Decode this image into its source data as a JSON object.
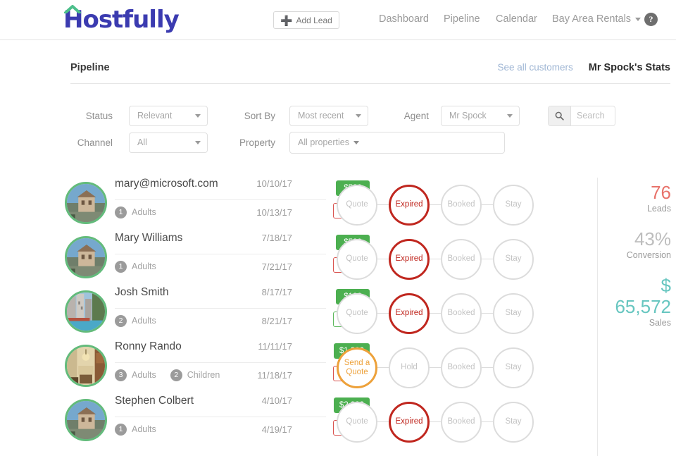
{
  "brand": {
    "name": "Hostfully",
    "roof_icon": "house-roof-icon",
    "color": "#3b3bb0",
    "accent": "#4cbf8b"
  },
  "topbar": {
    "add_lead_label": "Add Lead",
    "add_lead_icon": "plus-icon",
    "help_icon": "question-mark-icon",
    "nav": [
      {
        "label": "Dashboard",
        "dropdown": false
      },
      {
        "label": "Pipeline",
        "dropdown": false
      },
      {
        "label": "Calendar",
        "dropdown": false
      },
      {
        "label": "Bay Area Rentals",
        "dropdown": true
      }
    ]
  },
  "section": {
    "title": "Pipeline",
    "see_all_label": "See all customers",
    "stats_title": "Mr Spock's Stats"
  },
  "filters": {
    "status": {
      "label": "Status",
      "value": "Relevant"
    },
    "sort_by": {
      "label": "Sort By",
      "value": "Most recent"
    },
    "agent": {
      "label": "Agent",
      "value": "Mr Spock"
    },
    "channel": {
      "label": "Channel",
      "value": "All"
    },
    "property": {
      "label": "Property",
      "value": "All properties"
    },
    "search": {
      "placeholder": "Search",
      "value": "",
      "icon": "search-icon"
    }
  },
  "leads": [
    {
      "name": "mary@microsoft.com",
      "date_from": "10/10/17",
      "date_to": "10/13/17",
      "amount": "$520",
      "duration": "3 days",
      "duration_state": "alert",
      "adults": "1",
      "adults_label": "Adults",
      "children": null,
      "children_label": null,
      "avatar": "victorian-house-photo",
      "stages": [
        {
          "label": "Quote",
          "state": "inactive"
        },
        {
          "label": "Expired",
          "state": "expired"
        },
        {
          "label": "Booked",
          "state": "inactive"
        },
        {
          "label": "Stay",
          "state": "inactive"
        }
      ]
    },
    {
      "name": "Mary Williams",
      "date_from": "7/18/17",
      "date_to": "7/21/17",
      "amount": "$520",
      "duration": "3 days",
      "duration_state": "alert",
      "adults": "1",
      "adults_label": "Adults",
      "children": null,
      "children_label": null,
      "avatar": "victorian-house-photo",
      "stages": [
        {
          "label": "Quote",
          "state": "inactive"
        },
        {
          "label": "Expired",
          "state": "expired"
        },
        {
          "label": "Booked",
          "state": "inactive"
        },
        {
          "label": "Stay",
          "state": "inactive"
        }
      ]
    },
    {
      "name": "Josh Smith",
      "date_from": "8/17/17",
      "date_to": "8/21/17",
      "amount": "$100",
      "duration": "4 days",
      "duration_state": "ok",
      "adults": "2",
      "adults_label": "Adults",
      "children": null,
      "children_label": null,
      "avatar": "city-canal-photo",
      "stages": [
        {
          "label": "Quote",
          "state": "inactive"
        },
        {
          "label": "Expired",
          "state": "expired"
        },
        {
          "label": "Booked",
          "state": "inactive"
        },
        {
          "label": "Stay",
          "state": "inactive"
        }
      ]
    },
    {
      "name": "Ronny Rando",
      "date_from": "11/11/17",
      "date_to": "11/18/17",
      "amount": "$1,200",
      "duration": "7 days",
      "duration_state": "alert",
      "adults": "3",
      "adults_label": "Adults",
      "children": "2",
      "children_label": "Children",
      "avatar": "living-room-interior-photo",
      "stages": [
        {
          "label": "Send a Quote",
          "state": "quote-active"
        },
        {
          "label": "Hold",
          "state": "inactive"
        },
        {
          "label": "Booked",
          "state": "inactive"
        },
        {
          "label": "Stay",
          "state": "inactive"
        }
      ]
    },
    {
      "name": "Stephen Colbert",
      "date_from": "4/10/17",
      "date_to": "4/19/17",
      "amount": "$2,020",
      "duration": "9 days",
      "duration_state": "alert",
      "adults": "1",
      "adults_label": "Adults",
      "children": null,
      "children_label": null,
      "avatar": "victorian-house-photo",
      "stages": [
        {
          "label": "Quote",
          "state": "inactive"
        },
        {
          "label": "Expired",
          "state": "expired"
        },
        {
          "label": "Booked",
          "state": "inactive"
        },
        {
          "label": "Stay",
          "state": "inactive"
        }
      ]
    }
  ],
  "stats": [
    {
      "value": "76",
      "label": "Leads",
      "color": "#e8736b"
    },
    {
      "value": "43%",
      "label": "Conversion",
      "color": "#bdbdbd"
    },
    {
      "value": "$ 65,572",
      "label": "Sales",
      "color": "#67c6c0"
    }
  ]
}
